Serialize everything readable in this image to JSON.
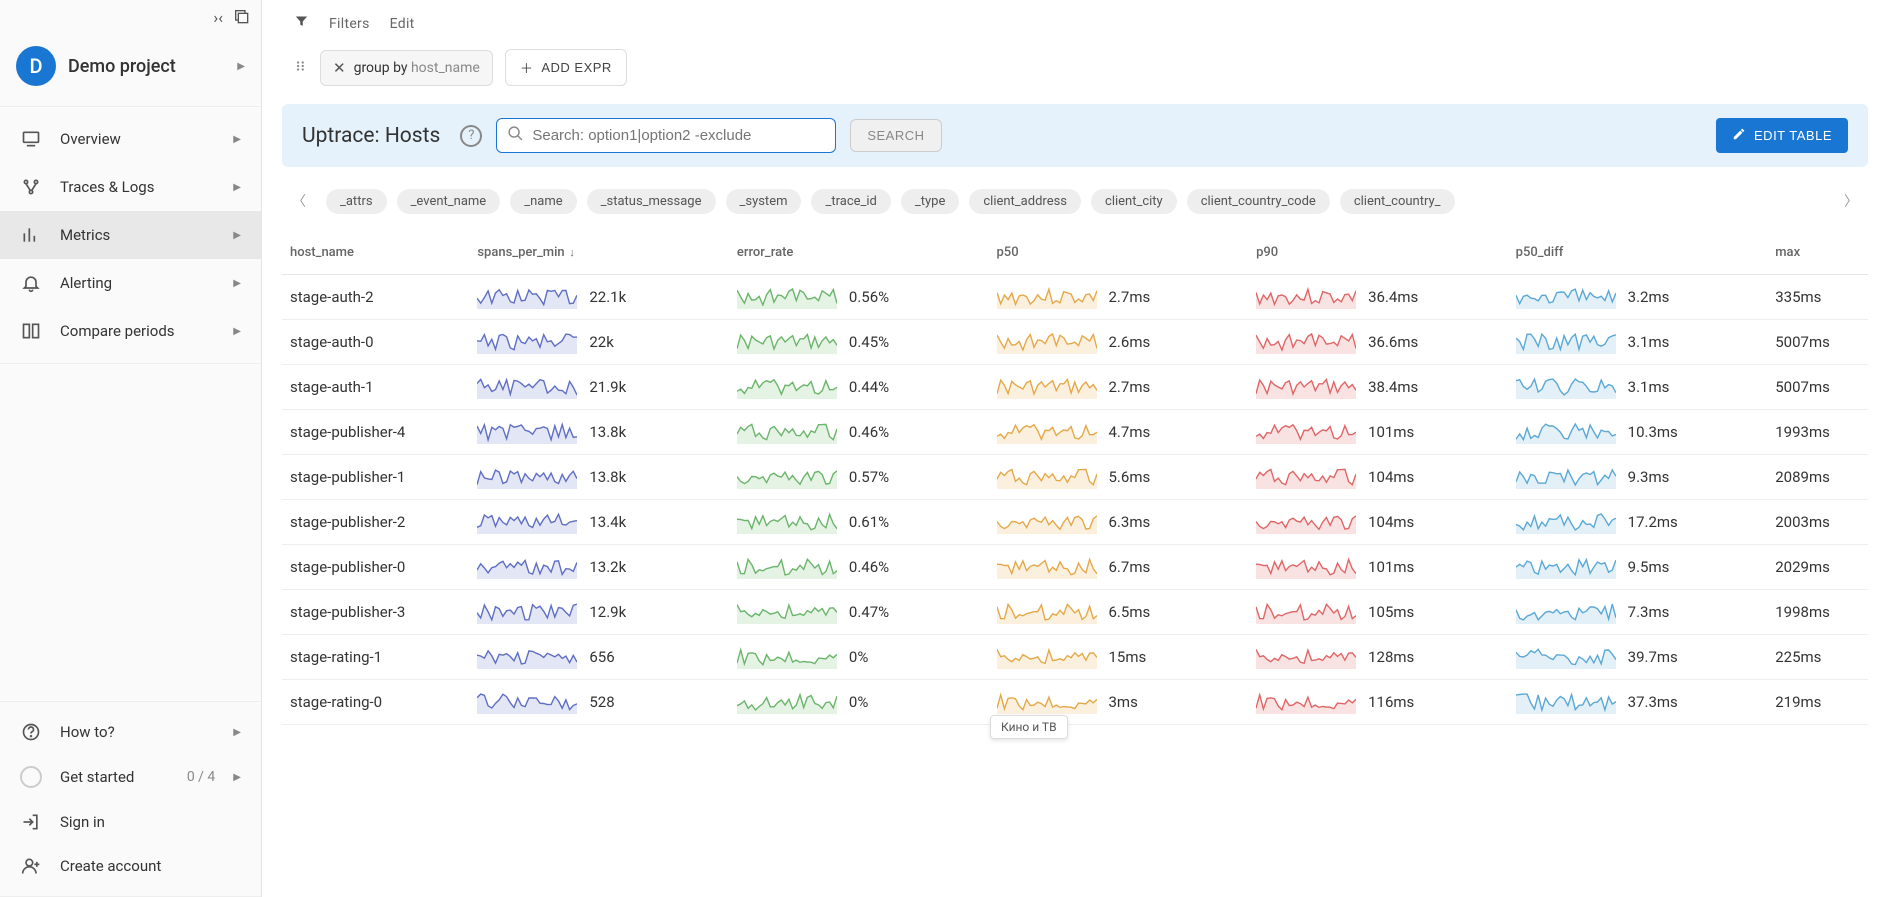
{
  "project": {
    "initial": "D",
    "name": "Demo project"
  },
  "sidebar": {
    "items": [
      {
        "label": "Overview",
        "icon": "monitor"
      },
      {
        "label": "Traces & Logs",
        "icon": "graph"
      },
      {
        "label": "Metrics",
        "icon": "chart",
        "active": true
      },
      {
        "label": "Alerting",
        "icon": "bell"
      },
      {
        "label": "Compare periods",
        "icon": "compare"
      }
    ],
    "bottom": [
      {
        "label": "How to?",
        "icon": "help"
      },
      {
        "label": "Get started",
        "icon": "ring",
        "progress": "0 / 4"
      },
      {
        "label": "Sign in",
        "icon": "signin"
      },
      {
        "label": "Create account",
        "icon": "adduser"
      }
    ]
  },
  "toolbar": {
    "filters_label": "Filters",
    "edit_label": "Edit",
    "group_by_prefix": "group by ",
    "group_by_value": "host_name",
    "add_expr_label": "ADD EXPR"
  },
  "panel": {
    "title": "Uptrace: Hosts",
    "search_placeholder": "Search: option1|option2 -exclude",
    "search_btn": "SEARCH",
    "edit_table_btn": "EDIT TABLE"
  },
  "tags": [
    "_attrs",
    "_event_name",
    "_name",
    "_status_message",
    "_system",
    "_trace_id",
    "_type",
    "client_address",
    "client_city",
    "client_country_code",
    "client_country_"
  ],
  "table": {
    "columns": [
      "host_name",
      "spans_per_min",
      "error_rate",
      "p50",
      "p90",
      "p50_diff",
      "max"
    ],
    "sort_col": "spans_per_min",
    "sort_dir": "desc",
    "rows": [
      {
        "host_name": "stage-auth-2",
        "spans_per_min": "22.1k",
        "error_rate": "0.56%",
        "p50": "2.7ms",
        "p90": "36.4ms",
        "p50_diff": "3.2ms",
        "max": "335ms"
      },
      {
        "host_name": "stage-auth-0",
        "spans_per_min": "22k",
        "error_rate": "0.45%",
        "p50": "2.6ms",
        "p90": "36.6ms",
        "p50_diff": "3.1ms",
        "max": "5007ms"
      },
      {
        "host_name": "stage-auth-1",
        "spans_per_min": "21.9k",
        "error_rate": "0.44%",
        "p50": "2.7ms",
        "p90": "38.4ms",
        "p50_diff": "3.1ms",
        "max": "5007ms"
      },
      {
        "host_name": "stage-publisher-4",
        "spans_per_min": "13.8k",
        "error_rate": "0.46%",
        "p50": "4.7ms",
        "p90": "101ms",
        "p50_diff": "10.3ms",
        "max": "1993ms"
      },
      {
        "host_name": "stage-publisher-1",
        "spans_per_min": "13.8k",
        "error_rate": "0.57%",
        "p50": "5.6ms",
        "p90": "104ms",
        "p50_diff": "9.3ms",
        "max": "2089ms"
      },
      {
        "host_name": "stage-publisher-2",
        "spans_per_min": "13.4k",
        "error_rate": "0.61%",
        "p50": "6.3ms",
        "p90": "104ms",
        "p50_diff": "17.2ms",
        "max": "2003ms"
      },
      {
        "host_name": "stage-publisher-0",
        "spans_per_min": "13.2k",
        "error_rate": "0.46%",
        "p50": "6.7ms",
        "p90": "101ms",
        "p50_diff": "9.5ms",
        "max": "2029ms"
      },
      {
        "host_name": "stage-publisher-3",
        "spans_per_min": "12.9k",
        "error_rate": "0.47%",
        "p50": "6.5ms",
        "p90": "105ms",
        "p50_diff": "7.3ms",
        "max": "1998ms"
      },
      {
        "host_name": "stage-rating-1",
        "spans_per_min": "656",
        "error_rate": "0%",
        "p50": "15ms",
        "p90": "128ms",
        "p50_diff": "39.7ms",
        "max": "225ms"
      },
      {
        "host_name": "stage-rating-0",
        "spans_per_min": "528",
        "error_rate": "0%",
        "p50": "3ms",
        "p90": "116ms",
        "p50_diff": "37.3ms",
        "max": "219ms"
      }
    ]
  },
  "spark_colors": {
    "spans_per_min": {
      "stroke": "#5e6fc4",
      "fill": "#e2e6f5"
    },
    "error_rate": {
      "stroke": "#6bb56b",
      "fill": "#e5f3e5"
    },
    "p50": {
      "stroke": "#e5a849",
      "fill": "#fbf0de"
    },
    "p90": {
      "stroke": "#e06666",
      "fill": "#f9e2e2"
    },
    "p50_diff": {
      "stroke": "#5aa8d6",
      "fill": "#e3f0f8"
    }
  },
  "tooltip": "Кино и ТВ"
}
